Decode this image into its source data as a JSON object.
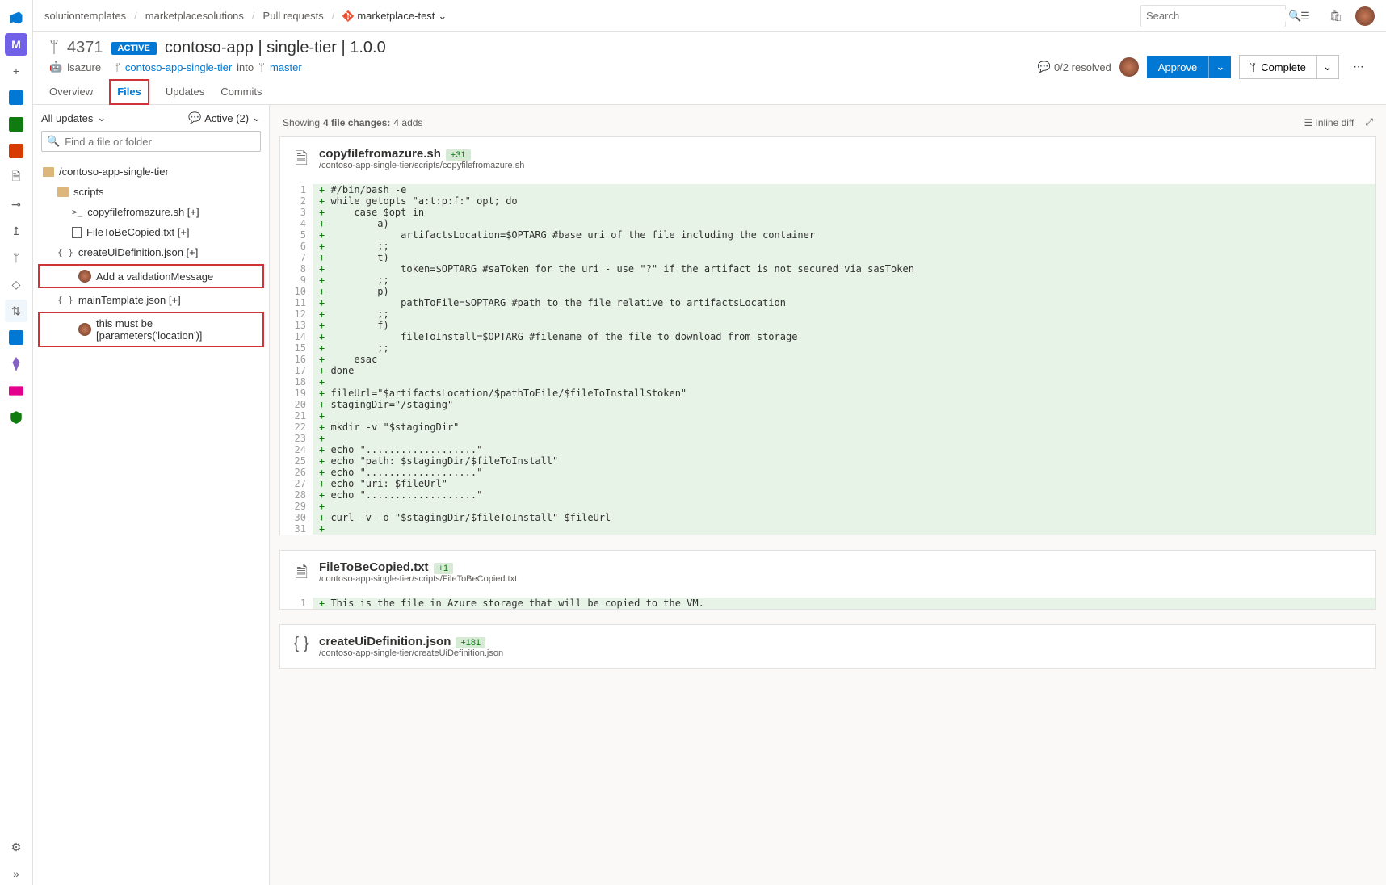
{
  "breadcrumbs": [
    "solutiontemplates",
    "marketplacesolutions",
    "Pull requests"
  ],
  "repo_name": "marketplace-test",
  "search_placeholder": "Search",
  "pr": {
    "number": "4371",
    "status": "ACTIVE",
    "title": "contoso-app | single-tier | 1.0.0",
    "author": "lsazure",
    "source_branch": "contoso-app-single-tier",
    "into": "into",
    "target_branch": "master",
    "resolved": "0/2 resolved",
    "approve_label": "Approve",
    "complete_label": "Complete"
  },
  "tabs": [
    "Overview",
    "Files",
    "Updates",
    "Commits"
  ],
  "active_tab": "Files",
  "sidebar": {
    "updates_label": "All updates",
    "active_label": "Active (2)",
    "find_placeholder": "Find a file or folder",
    "root": "/contoso-app-single-tier",
    "scripts_label": "scripts",
    "file_sh": "copyfilefromazure.sh [+]",
    "file_txt": "FileToBeCopied.txt [+]",
    "file_createui": "createUiDefinition.json [+]",
    "comment1": "Add a validationMessage",
    "file_main": "mainTemplate.json [+]",
    "comment2": "this must be [parameters('location')]"
  },
  "summary": {
    "showing": "Showing",
    "changes": "4 file changes:",
    "adds": "4 adds",
    "inline": "Inline diff"
  },
  "files": [
    {
      "name": "copyfilefromazure.sh",
      "badge": "+31",
      "path": "/contoso-app-single-tier/scripts/copyfilefromazure.sh",
      "icon": "sh",
      "lines": [
        "#/bin/bash -e",
        "while getopts \"a:t:p:f:\" opt; do",
        "    case $opt in",
        "        a)",
        "            artifactsLocation=$OPTARG #base uri of the file including the container",
        "        ;;",
        "        t)",
        "            token=$OPTARG #saToken for the uri - use \"?\" if the artifact is not secured via sasToken",
        "        ;;",
        "        p)",
        "            pathToFile=$OPTARG #path to the file relative to artifactsLocation",
        "        ;;",
        "        f)",
        "            fileToInstall=$OPTARG #filename of the file to download from storage",
        "        ;;",
        "    esac",
        "done",
        "",
        "fileUrl=\"$artifactsLocation/$pathToFile/$fileToInstall$token\"",
        "stagingDir=\"/staging\"",
        "",
        "mkdir -v \"$stagingDir\"",
        "",
        "echo \"...................\"",
        "echo \"path: $stagingDir/$fileToInstall\"",
        "echo \"...................\"",
        "echo \"uri: $fileUrl\"",
        "echo \"...................\"",
        "",
        "curl -v -o \"$stagingDir/$fileToInstall\" $fileUrl",
        ""
      ]
    },
    {
      "name": "FileToBeCopied.txt",
      "badge": "+1",
      "path": "/contoso-app-single-tier/scripts/FileToBeCopied.txt",
      "icon": "txt",
      "lines": [
        "This is the file in Azure storage that will be copied to the VM."
      ]
    },
    {
      "name": "createUiDefinition.json",
      "badge": "+181",
      "path": "/contoso-app-single-tier/createUiDefinition.json",
      "icon": "json",
      "lines": []
    }
  ]
}
